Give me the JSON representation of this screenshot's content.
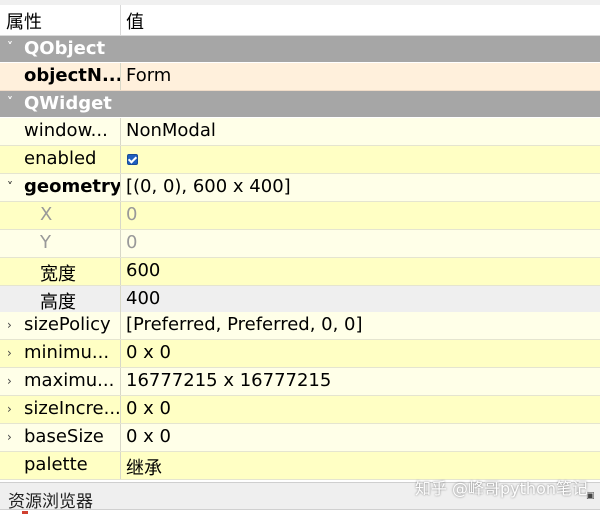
{
  "header": {
    "col_property": "属性",
    "col_value": "值"
  },
  "groups": {
    "qobject": "QObject",
    "qwidget": "QWidget"
  },
  "rows": {
    "objectName": {
      "name": "objectN...",
      "value": "Form"
    },
    "windowModality": {
      "name": "window...",
      "value": "NonModal"
    },
    "enabled": {
      "name": "enabled",
      "checked": true
    },
    "geometry": {
      "name": "geometry",
      "value": "[(0, 0), 600 x 400]"
    },
    "x": {
      "name": "X",
      "value": "0"
    },
    "y": {
      "name": "Y",
      "value": "0"
    },
    "width": {
      "name": "宽度",
      "value": "600"
    },
    "height": {
      "name": "高度",
      "value": "400"
    },
    "sizePolicy": {
      "name": "sizePolicy",
      "value": "[Preferred, Preferred, 0, 0]"
    },
    "minimumSize": {
      "name": "minimu...",
      "value": "0 x 0"
    },
    "maximumSize": {
      "name": "maximu...",
      "value": "16777215 x 16777215"
    },
    "sizeIncrement": {
      "name": "sizeIncre...",
      "value": "0 x 0"
    },
    "baseSize": {
      "name": "baseSize",
      "value": "0 x 0"
    },
    "palette": {
      "name": "palette",
      "value": "继承"
    }
  },
  "bottom_panel": {
    "title": "资源浏览器"
  },
  "watermark": "知乎 @峰哥python笔记",
  "colors": {
    "group_header": "#a6a6a6",
    "row_light": "#ffffe8",
    "row_yellow": "#ffffc4",
    "row_selected": "#efefef",
    "row_peach": "#fff0dc",
    "checkbox": "#1f5fbf"
  }
}
